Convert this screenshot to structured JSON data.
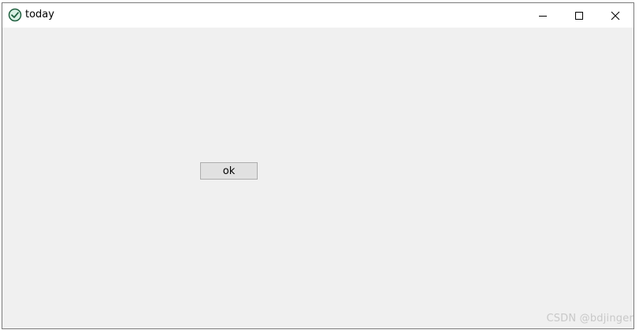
{
  "window": {
    "title": "today",
    "icon": "check-circle-icon",
    "controls": {
      "minimize": "minimize-icon",
      "maximize": "maximize-icon",
      "close": "close-icon"
    }
  },
  "main": {
    "ok_label": "ok"
  },
  "watermark": "CSDN @bdjinger",
  "colors": {
    "icon_accent": "#2e8b57",
    "client_bg": "#f0f0f0",
    "button_bg": "#e1e1e1"
  }
}
